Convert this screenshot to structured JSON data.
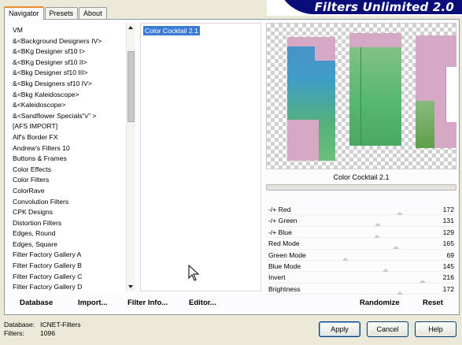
{
  "tabs": [
    "Navigator",
    "Presets",
    "About"
  ],
  "title": "Filters Unlimited 2.0",
  "categories": [
    "VM",
    "&<Background Designers IV>",
    "&<BKg Designer sf10 I>",
    "&<BKg Designer sf10 II>",
    "&<Bkg Designer sf10 III>",
    "&<Bkg Designers sf10 IV>",
    "&<Bkg Kaleidoscope>",
    "&<Kaleidoscope>",
    "&<Sandflower Specials\"v\" >",
    "[AFS IMPORT]",
    "Alf's Border FX",
    "Andrew's Filters 10",
    "Buttons & Frames",
    "Color Effects",
    "Color Filters",
    "ColorRave",
    "Convolution Filters",
    "CPK Designs",
    "Distortion Filters",
    "Edges, Round",
    "Edges, Square",
    "Filter Factory Gallery A",
    "Filter Factory Gallery B",
    "Filter Factory Gallery C",
    "Filter Factory Gallery D"
  ],
  "filters": {
    "selected": "Color Cocktail 2.1"
  },
  "preview_label": "Color Cocktail 2.1",
  "params": [
    {
      "label": "-/+ Red",
      "value": 172,
      "fraction": 0.675
    },
    {
      "label": "-/+ Green",
      "value": 131,
      "fraction": 0.514
    },
    {
      "label": "-/+ Blue",
      "value": 129,
      "fraction": 0.506
    },
    {
      "label": "Red Mode",
      "value": 165,
      "fraction": 0.647
    },
    {
      "label": "Green Mode",
      "value": 69,
      "fraction": 0.271
    },
    {
      "label": "Blue Mode",
      "value": 145,
      "fraction": 0.569
    },
    {
      "label": "Invert",
      "value": 216,
      "fraction": 0.847
    },
    {
      "label": "Brightness",
      "value": 172,
      "fraction": 0.675
    }
  ],
  "bottom": {
    "database": "Database",
    "import": "Import...",
    "filter_info": "Filter Info...",
    "editor": "Editor...",
    "randomize": "Randomize",
    "reset": "Reset"
  },
  "info": {
    "database_label": "Database:",
    "database_value": "ICNET-Filters",
    "filters_label": "Filters:",
    "filters_value": "1096"
  },
  "buttons": {
    "apply": "Apply",
    "cancel": "Cancel",
    "help": "Help"
  },
  "colors": {
    "banner": "#0a0c7a",
    "selection": "#3a7bd5",
    "active_tab": "#e68b2c"
  }
}
